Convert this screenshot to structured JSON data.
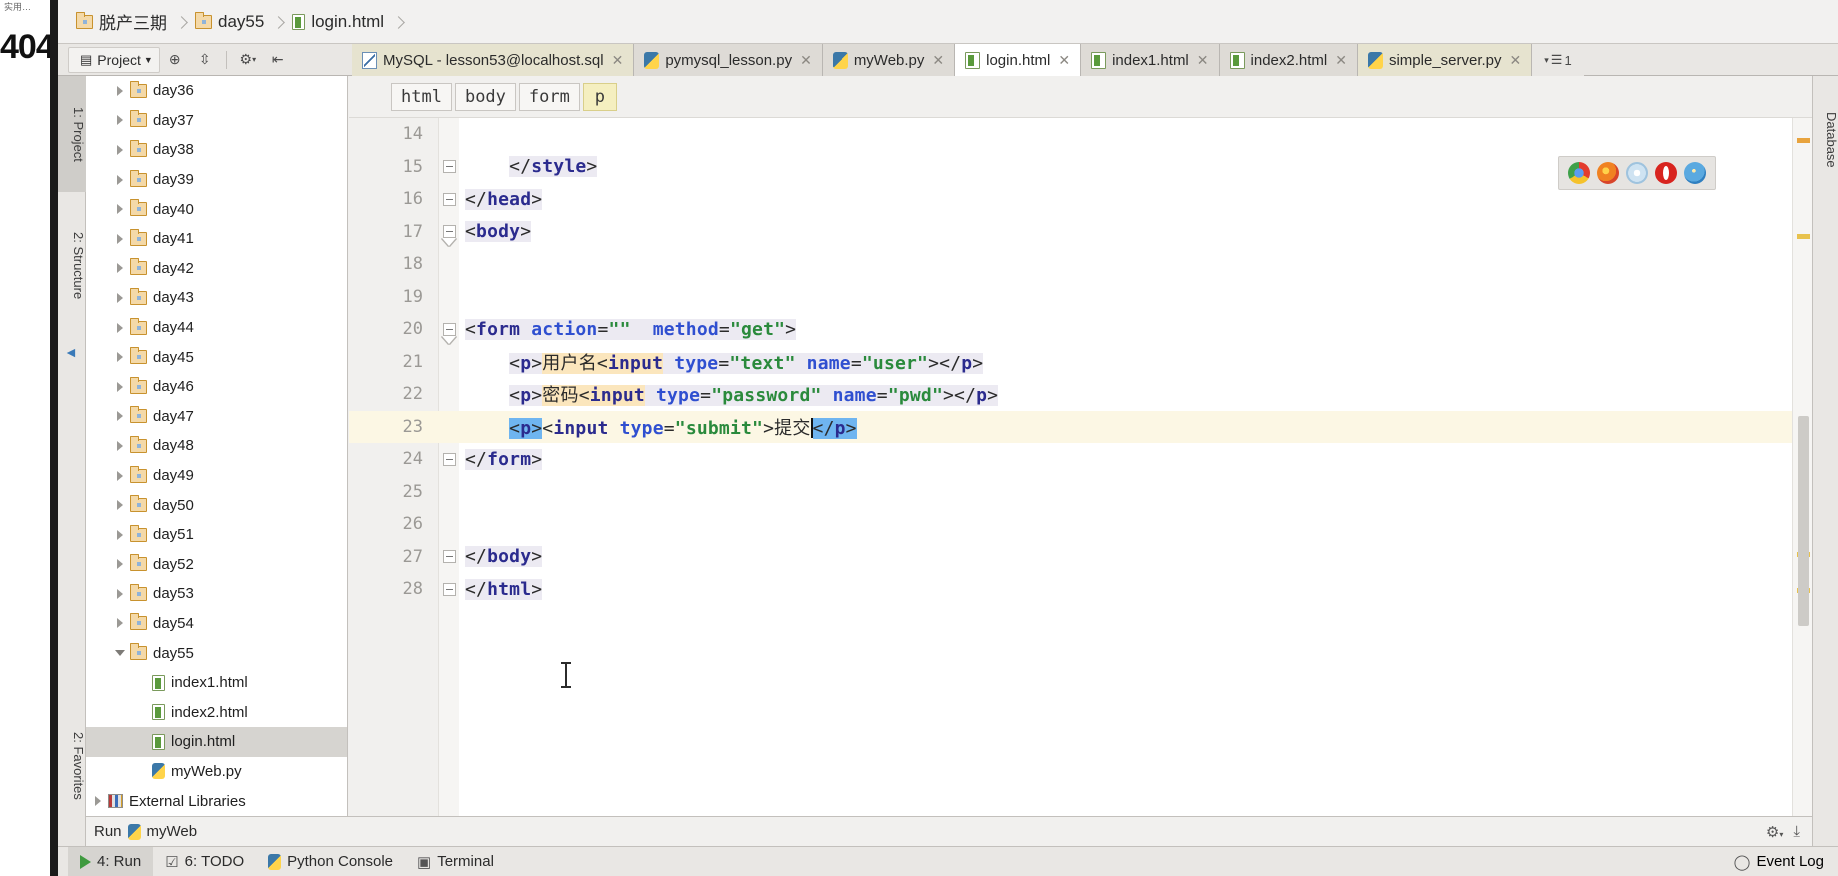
{
  "window": {
    "video_overlay_number": "404",
    "video_overlay_cjk": "实用…"
  },
  "navbar": {
    "crumbs": [
      {
        "label": "脱产三期",
        "icon": "folder-icon"
      },
      {
        "label": "day55",
        "icon": "folder-icon"
      },
      {
        "label": "login.html",
        "icon": "html-file-icon"
      }
    ]
  },
  "toolbar": {
    "project_button": "Project",
    "icons": [
      "locate-icon",
      "collapse-all-icon",
      "settings-gear-icon",
      "hide-icon"
    ]
  },
  "tabs": [
    {
      "label": "MySQL - lesson53@localhost.sql",
      "icon": "sql-file-icon",
      "close": "✕",
      "state": "modified"
    },
    {
      "label": "pymysql_lesson.py",
      "icon": "python-file-icon",
      "close": "✕",
      "state": "normal"
    },
    {
      "label": "myWeb.py",
      "icon": "python-file-icon",
      "close": "✕",
      "state": "normal"
    },
    {
      "label": "login.html",
      "icon": "html-file-icon",
      "close": "✕",
      "state": "active"
    },
    {
      "label": "index1.html",
      "icon": "html-file-icon",
      "close": "✕",
      "state": "normal"
    },
    {
      "label": "index2.html",
      "icon": "html-file-icon",
      "close": "✕",
      "state": "normal"
    },
    {
      "label": "simple_server.py",
      "icon": "python-file-icon",
      "close": "✕",
      "state": "modified"
    }
  ],
  "tabs_overflow_label": "1",
  "tool_strips": {
    "left": [
      "1: Project",
      "2: Structure",
      "2: Favorites"
    ],
    "right": [
      "Database"
    ]
  },
  "tree": {
    "items": [
      {
        "label": "day36",
        "type": "folder",
        "expanded": false,
        "indent": 1,
        "selected": false
      },
      {
        "label": "day37",
        "type": "folder",
        "expanded": false,
        "indent": 1,
        "selected": false
      },
      {
        "label": "day38",
        "type": "folder",
        "expanded": false,
        "indent": 1,
        "selected": false
      },
      {
        "label": "day39",
        "type": "folder",
        "expanded": false,
        "indent": 1,
        "selected": false
      },
      {
        "label": "day40",
        "type": "folder",
        "expanded": false,
        "indent": 1,
        "selected": false
      },
      {
        "label": "day41",
        "type": "folder",
        "expanded": false,
        "indent": 1,
        "selected": false
      },
      {
        "label": "day42",
        "type": "folder",
        "expanded": false,
        "indent": 1,
        "selected": false
      },
      {
        "label": "day43",
        "type": "folder",
        "expanded": false,
        "indent": 1,
        "selected": false
      },
      {
        "label": "day44",
        "type": "folder",
        "expanded": false,
        "indent": 1,
        "selected": false
      },
      {
        "label": "day45",
        "type": "folder",
        "expanded": false,
        "indent": 1,
        "selected": false
      },
      {
        "label": "day46",
        "type": "folder",
        "expanded": false,
        "indent": 1,
        "selected": false
      },
      {
        "label": "day47",
        "type": "folder",
        "expanded": false,
        "indent": 1,
        "selected": false
      },
      {
        "label": "day48",
        "type": "folder",
        "expanded": false,
        "indent": 1,
        "selected": false
      },
      {
        "label": "day49",
        "type": "folder",
        "expanded": false,
        "indent": 1,
        "selected": false
      },
      {
        "label": "day50",
        "type": "folder",
        "expanded": false,
        "indent": 1,
        "selected": false
      },
      {
        "label": "day51",
        "type": "folder",
        "expanded": false,
        "indent": 1,
        "selected": false
      },
      {
        "label": "day52",
        "type": "folder",
        "expanded": false,
        "indent": 1,
        "selected": false
      },
      {
        "label": "day53",
        "type": "folder",
        "expanded": false,
        "indent": 1,
        "selected": false
      },
      {
        "label": "day54",
        "type": "folder",
        "expanded": false,
        "indent": 1,
        "selected": false
      },
      {
        "label": "day55",
        "type": "folder",
        "expanded": true,
        "indent": 1,
        "selected": false
      },
      {
        "label": "index1.html",
        "type": "html",
        "expanded": null,
        "indent": 2,
        "selected": false
      },
      {
        "label": "index2.html",
        "type": "html",
        "expanded": null,
        "indent": 2,
        "selected": false
      },
      {
        "label": "login.html",
        "type": "html",
        "expanded": null,
        "indent": 2,
        "selected": true
      },
      {
        "label": "myWeb.py",
        "type": "python",
        "expanded": null,
        "indent": 2,
        "selected": false
      },
      {
        "label": "External Libraries",
        "type": "library",
        "expanded": false,
        "indent": 0,
        "selected": false
      }
    ]
  },
  "breadcrumb_chips": [
    {
      "label": "html",
      "highlighted": false
    },
    {
      "label": "body",
      "highlighted": false
    },
    {
      "label": "form",
      "highlighted": false
    },
    {
      "label": "p",
      "highlighted": true
    }
  ],
  "editor": {
    "lines": [
      {
        "num": "14",
        "fold": "none",
        "current": false,
        "segments": []
      },
      {
        "num": "15",
        "fold": "minus",
        "current": false,
        "segments": [
          {
            "t": "    ",
            "c": "tx"
          },
          {
            "t": "</",
            "c": "br bg-soft"
          },
          {
            "t": "style",
            "c": "tg bg-soft"
          },
          {
            "t": ">",
            "c": "br bg-soft"
          }
        ]
      },
      {
        "num": "16",
        "fold": "minus",
        "current": false,
        "segments": [
          {
            "t": "</",
            "c": "br bg-soft"
          },
          {
            "t": "head",
            "c": "tg bg-soft"
          },
          {
            "t": ">",
            "c": "br bg-soft"
          }
        ]
      },
      {
        "num": "17",
        "fold": "tri",
        "current": false,
        "segments": [
          {
            "t": "<",
            "c": "br bg-soft"
          },
          {
            "t": "body",
            "c": "tg bg-soft"
          },
          {
            "t": ">",
            "c": "br bg-soft"
          }
        ]
      },
      {
        "num": "18",
        "fold": "none",
        "current": false,
        "segments": []
      },
      {
        "num": "19",
        "fold": "none",
        "current": false,
        "segments": []
      },
      {
        "num": "20",
        "fold": "tri",
        "current": false,
        "segments": [
          {
            "t": "<",
            "c": "br bg-soft"
          },
          {
            "t": "form",
            "c": "tg bg-soft"
          },
          {
            "t": " ",
            "c": "tx bg-soft"
          },
          {
            "t": "action",
            "c": "at bg-soft"
          },
          {
            "t": "=",
            "c": "br bg-soft"
          },
          {
            "t": "\"\"",
            "c": "st bg-soft"
          },
          {
            "t": "  ",
            "c": "tx bg-soft"
          },
          {
            "t": "method",
            "c": "at bg-soft"
          },
          {
            "t": "=",
            "c": "br bg-soft"
          },
          {
            "t": "\"get\"",
            "c": "st bg-soft"
          },
          {
            "t": ">",
            "c": "br bg-soft"
          }
        ]
      },
      {
        "num": "21",
        "fold": "none",
        "current": false,
        "segments": [
          {
            "t": "    ",
            "c": "tx"
          },
          {
            "t": "<",
            "c": "br bg-soft"
          },
          {
            "t": "p",
            "c": "tg bg-soft"
          },
          {
            "t": ">",
            "c": "br bg-soft"
          },
          {
            "t": "用户名",
            "c": "tx bg-amber"
          },
          {
            "t": "<",
            "c": "br bg-amber"
          },
          {
            "t": "input",
            "c": "tg bg-amber"
          },
          {
            "t": " ",
            "c": "tx bg-soft"
          },
          {
            "t": "type",
            "c": "at bg-soft"
          },
          {
            "t": "=",
            "c": "br bg-soft"
          },
          {
            "t": "\"text\"",
            "c": "st bg-soft"
          },
          {
            "t": " ",
            "c": "tx bg-soft"
          },
          {
            "t": "name",
            "c": "at bg-soft"
          },
          {
            "t": "=",
            "c": "br bg-soft"
          },
          {
            "t": "\"user\"",
            "c": "st bg-soft"
          },
          {
            "t": ">",
            "c": "br bg-soft"
          },
          {
            "t": "</",
            "c": "br bg-soft"
          },
          {
            "t": "p",
            "c": "tg bg-soft"
          },
          {
            "t": ">",
            "c": "br bg-soft"
          }
        ]
      },
      {
        "num": "22",
        "fold": "none",
        "current": false,
        "segments": [
          {
            "t": "    ",
            "c": "tx"
          },
          {
            "t": "<",
            "c": "br bg-soft"
          },
          {
            "t": "p",
            "c": "tg bg-soft"
          },
          {
            "t": ">",
            "c": "br bg-soft"
          },
          {
            "t": "密码",
            "c": "tx bg-amber"
          },
          {
            "t": "<",
            "c": "br bg-amber"
          },
          {
            "t": "input",
            "c": "tg bg-amber"
          },
          {
            "t": " ",
            "c": "tx bg-soft"
          },
          {
            "t": "type",
            "c": "at bg-soft"
          },
          {
            "t": "=",
            "c": "br bg-soft"
          },
          {
            "t": "\"password\"",
            "c": "st bg-soft"
          },
          {
            "t": " ",
            "c": "tx bg-soft"
          },
          {
            "t": "name",
            "c": "at bg-soft"
          },
          {
            "t": "=",
            "c": "br bg-soft"
          },
          {
            "t": "\"pwd\"",
            "c": "st bg-soft"
          },
          {
            "t": ">",
            "c": "br bg-soft"
          },
          {
            "t": "</",
            "c": "br bg-soft"
          },
          {
            "t": "p",
            "c": "tg bg-soft"
          },
          {
            "t": ">",
            "c": "br bg-soft"
          }
        ]
      },
      {
        "num": "23",
        "fold": "none",
        "current": true,
        "segments": [
          {
            "t": "    ",
            "c": "tx"
          },
          {
            "t": "<",
            "c": "br sel-blue"
          },
          {
            "t": "p",
            "c": "tg sel-blue"
          },
          {
            "t": ">",
            "c": "br sel-blue"
          },
          {
            "t": "<",
            "c": "br"
          },
          {
            "t": "input",
            "c": "tg"
          },
          {
            "t": " ",
            "c": "tx"
          },
          {
            "t": "type",
            "c": "at"
          },
          {
            "t": "=",
            "c": "br"
          },
          {
            "t": "\"submit\"",
            "c": "st"
          },
          {
            "t": ">",
            "c": "br"
          },
          {
            "t": "提交",
            "c": "tx"
          },
          {
            "t": "CARET",
            "c": "caret"
          },
          {
            "t": "</",
            "c": "br sel-blue"
          },
          {
            "t": "p",
            "c": "tg sel-blue"
          },
          {
            "t": ">",
            "c": "br sel-blue"
          }
        ]
      },
      {
        "num": "24",
        "fold": "minus",
        "current": false,
        "segments": [
          {
            "t": "</",
            "c": "br bg-soft"
          },
          {
            "t": "form",
            "c": "tg bg-soft"
          },
          {
            "t": ">",
            "c": "br bg-soft"
          }
        ]
      },
      {
        "num": "25",
        "fold": "none",
        "current": false,
        "segments": []
      },
      {
        "num": "26",
        "fold": "none",
        "current": false,
        "segments": []
      },
      {
        "num": "27",
        "fold": "minus",
        "current": false,
        "segments": [
          {
            "t": "</",
            "c": "br bg-soft"
          },
          {
            "t": "body",
            "c": "tg bg-soft"
          },
          {
            "t": ">",
            "c": "br bg-soft"
          }
        ]
      },
      {
        "num": "28",
        "fold": "minus",
        "current": false,
        "segments": [
          {
            "t": "</",
            "c": "br bg-soft"
          },
          {
            "t": "html",
            "c": "tg bg-soft"
          },
          {
            "t": ">",
            "c": "br bg-soft"
          }
        ]
      }
    ]
  },
  "browser_popup": {
    "browsers": [
      {
        "name": "chrome-icon"
      },
      {
        "name": "firefox-icon"
      },
      {
        "name": "safari-icon"
      },
      {
        "name": "opera-icon"
      },
      {
        "name": "internet-explorer-icon"
      }
    ]
  },
  "run_panel": {
    "label": "Run",
    "config": "myWeb"
  },
  "statusbar": {
    "items": [
      {
        "label": "4: Run",
        "icon": "run-play-icon",
        "selected": true
      },
      {
        "label": "6: TODO",
        "icon": "todo-icon",
        "selected": false
      },
      {
        "label": "Python Console",
        "icon": "python-console-icon",
        "selected": false
      },
      {
        "label": "Terminal",
        "icon": "terminal-icon",
        "selected": false
      }
    ],
    "event_log": "Event Log",
    "event_log_icon": "search-balloon-icon"
  },
  "colors": {
    "tag": "#2b2b8e",
    "attribute": "#2f4fd0",
    "string": "#2a8a3c",
    "current_line": "#fcf7e4",
    "selection": "#6fb5f0",
    "soft_highlight": "#eceaf2",
    "amber_highlight": "#fbe6bd",
    "chip_highlight": "#f5efc0"
  }
}
